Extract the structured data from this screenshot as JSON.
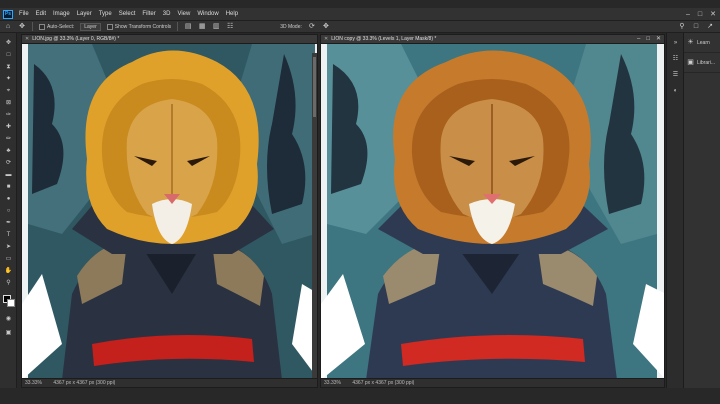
{
  "app": {
    "menu": [
      "File",
      "Edit",
      "Image",
      "Layer",
      "Type",
      "Select",
      "Filter",
      "3D",
      "View",
      "Window",
      "Help"
    ],
    "window_controls": [
      "–",
      "□",
      "✕"
    ]
  },
  "options": {
    "auto_select_label": "Auto-Select:",
    "auto_select_value": "Layer",
    "transform_label": "Show Transform Controls",
    "mode_label": "3D Mode:"
  },
  "colors": {
    "accent": "#31a8ff",
    "chrome": "#282828",
    "panel": "#323232",
    "mane_left": "#e0a12a",
    "mane_right": "#c57a2c",
    "robe": "#2a3140",
    "sash": "#c4201c"
  },
  "documents": [
    {
      "title": "LION.jpg @ 33.3% (Layer 0, RGB/8#) *",
      "zoom": "33.33%",
      "size": "4367 px x 4367 px (300 ppi)"
    },
    {
      "title": "LION copy @ 33.3% (Levels 1, Layer Mask/8) *",
      "zoom": "33.33%",
      "size": "4367 px x 4367 px (300 ppi)"
    }
  ],
  "panels": [
    {
      "icon": "learn-icon",
      "label": "Learn"
    },
    {
      "icon": "libraries-icon",
      "label": "Librari..."
    }
  ]
}
